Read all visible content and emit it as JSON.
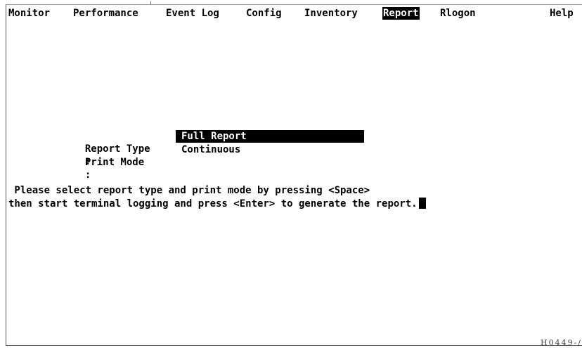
{
  "menu": {
    "items": [
      {
        "label": "Monitor"
      },
      {
        "label": "Performance"
      },
      {
        "label": "Event Log"
      },
      {
        "label": "Config"
      },
      {
        "label": "Inventory"
      },
      {
        "label": "Report",
        "active": true
      },
      {
        "label": "Rlogon"
      },
      {
        "label": "Help"
      }
    ]
  },
  "form": {
    "report_type": {
      "label": "Report Type",
      "separator": ":",
      "value": "Full Report"
    },
    "print_mode": {
      "label": "Print Mode",
      "separator": ":",
      "value": "Continuous"
    }
  },
  "instructions": {
    "line1": " Please select report type and print mode by pressing <Space>",
    "line2": "then start terminal logging and press <Enter> to generate the report."
  },
  "footer": {
    "figure_code": "H0449-/"
  },
  "colors": {
    "background": "#ffffff",
    "text": "#000000",
    "highlight_bg": "#000000",
    "highlight_text": "#ffffff"
  }
}
